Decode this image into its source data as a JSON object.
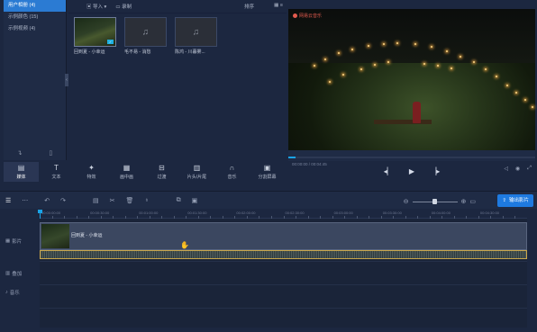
{
  "library": {
    "items": [
      {
        "label": "用户相册 (4)",
        "active": true
      },
      {
        "label": "示例颜色 (15)",
        "active": false
      },
      {
        "label": "示例视频 (4)",
        "active": false
      }
    ],
    "bottom_icons": [
      "import-icon",
      "new-file-icon"
    ]
  },
  "media": {
    "import_label": "导入 ▾",
    "record_label": "录制",
    "sort_label": "排序",
    "items": [
      {
        "label": "回到夏 - 小幸运",
        "type": "video"
      },
      {
        "label": "毛不易 - 消愁",
        "type": "audio"
      },
      {
        "label": "陈鸿 - 川暮雾...",
        "type": "audio"
      }
    ]
  },
  "preview": {
    "watermark": "网易云音乐",
    "timecode": "00:00:00 / 00:04:45",
    "progress": 0.03
  },
  "tabs": [
    {
      "label": "媒体",
      "icon": "media-icon",
      "active": true
    },
    {
      "label": "文本",
      "icon": "text-icon",
      "active": false
    },
    {
      "label": "特效",
      "icon": "effects-icon",
      "active": false
    },
    {
      "label": "画中画",
      "icon": "pip-icon",
      "active": false
    },
    {
      "label": "过渡",
      "icon": "transition-icon",
      "active": false
    },
    {
      "label": "片头/片尾",
      "icon": "intro-icon",
      "active": false
    },
    {
      "label": "音乐",
      "icon": "music-icon",
      "active": false
    },
    {
      "label": "分割屏幕",
      "icon": "splitscreen-icon",
      "active": false
    }
  ],
  "toolbar": {
    "export_label": "输出影片"
  },
  "ruler": {
    "labels": [
      "00:00:00:00",
      "00:00:30:00",
      "00:01:00:00",
      "00:01:30:00",
      "00:02:00:00",
      "00:02:30:00",
      "00:03:00:00",
      "00:03:30:00",
      "00:04:00:00",
      "00:04:30:00"
    ]
  },
  "tracks": [
    {
      "label": "影片",
      "icon": "film-icon"
    },
    {
      "label": "叠加",
      "icon": "overlay-icon"
    },
    {
      "label": "音乐",
      "icon": "music-note-icon"
    }
  ],
  "clip": {
    "name": "回到夏 - 小幸运"
  }
}
